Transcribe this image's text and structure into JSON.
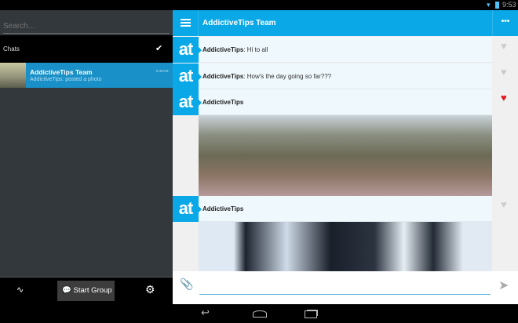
{
  "status": {
    "time": "9:53"
  },
  "sidebar": {
    "search_placeholder": "Search...",
    "section": "Chats",
    "chat": {
      "name": "AddictiveTips Team",
      "preview": "AddictiveTips: posted a photo",
      "time": "8:49AM"
    },
    "start_group": "Start Group"
  },
  "header": {
    "title": "AddictiveTips Team"
  },
  "messages": [
    {
      "avatar": "at",
      "sender": "AddictiveTips",
      "text": ": Hi to all",
      "liked": false
    },
    {
      "avatar": "at",
      "sender": "AddictiveTips",
      "text": ": How's the day going so far???",
      "liked": false
    },
    {
      "avatar": "at",
      "sender": "AddictiveTips",
      "text": "",
      "liked": true,
      "image": "great-wall-photo"
    },
    {
      "avatar": "at",
      "sender": "AddictiveTips",
      "text": "",
      "liked": false,
      "image": "penguins-photo"
    }
  ],
  "colors": {
    "accent": "#0ba8e7",
    "liked": "#e8151b"
  }
}
